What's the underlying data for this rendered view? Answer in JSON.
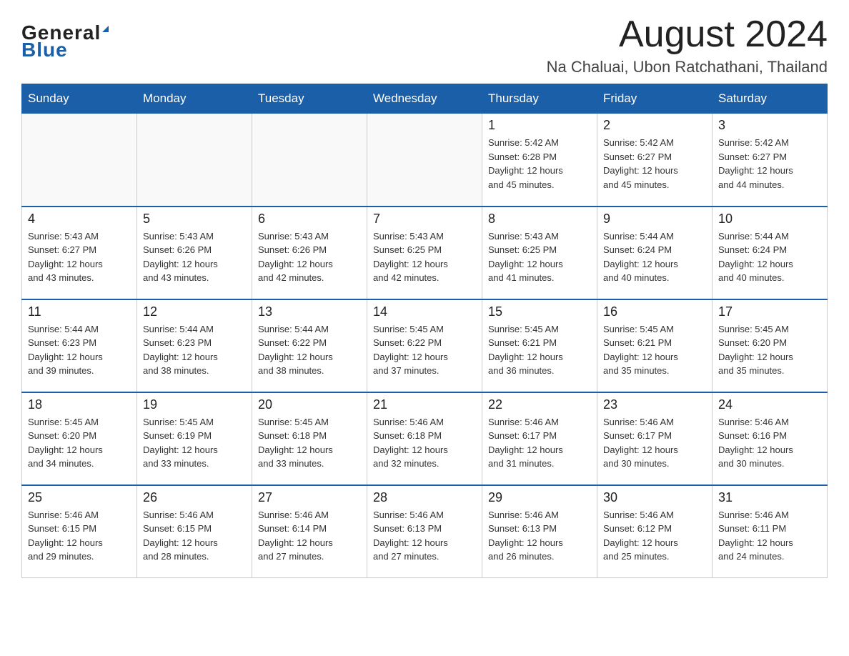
{
  "logo": {
    "general": "General",
    "blue": "Blue"
  },
  "title": "August 2024",
  "location": "Na Chaluai, Ubon Ratchathani, Thailand",
  "days_of_week": [
    "Sunday",
    "Monday",
    "Tuesday",
    "Wednesday",
    "Thursday",
    "Friday",
    "Saturday"
  ],
  "weeks": [
    [
      {
        "day": "",
        "info": ""
      },
      {
        "day": "",
        "info": ""
      },
      {
        "day": "",
        "info": ""
      },
      {
        "day": "",
        "info": ""
      },
      {
        "day": "1",
        "info": "Sunrise: 5:42 AM\nSunset: 6:28 PM\nDaylight: 12 hours\nand 45 minutes."
      },
      {
        "day": "2",
        "info": "Sunrise: 5:42 AM\nSunset: 6:27 PM\nDaylight: 12 hours\nand 45 minutes."
      },
      {
        "day": "3",
        "info": "Sunrise: 5:42 AM\nSunset: 6:27 PM\nDaylight: 12 hours\nand 44 minutes."
      }
    ],
    [
      {
        "day": "4",
        "info": "Sunrise: 5:43 AM\nSunset: 6:27 PM\nDaylight: 12 hours\nand 43 minutes."
      },
      {
        "day": "5",
        "info": "Sunrise: 5:43 AM\nSunset: 6:26 PM\nDaylight: 12 hours\nand 43 minutes."
      },
      {
        "day": "6",
        "info": "Sunrise: 5:43 AM\nSunset: 6:26 PM\nDaylight: 12 hours\nand 42 minutes."
      },
      {
        "day": "7",
        "info": "Sunrise: 5:43 AM\nSunset: 6:25 PM\nDaylight: 12 hours\nand 42 minutes."
      },
      {
        "day": "8",
        "info": "Sunrise: 5:43 AM\nSunset: 6:25 PM\nDaylight: 12 hours\nand 41 minutes."
      },
      {
        "day": "9",
        "info": "Sunrise: 5:44 AM\nSunset: 6:24 PM\nDaylight: 12 hours\nand 40 minutes."
      },
      {
        "day": "10",
        "info": "Sunrise: 5:44 AM\nSunset: 6:24 PM\nDaylight: 12 hours\nand 40 minutes."
      }
    ],
    [
      {
        "day": "11",
        "info": "Sunrise: 5:44 AM\nSunset: 6:23 PM\nDaylight: 12 hours\nand 39 minutes."
      },
      {
        "day": "12",
        "info": "Sunrise: 5:44 AM\nSunset: 6:23 PM\nDaylight: 12 hours\nand 38 minutes."
      },
      {
        "day": "13",
        "info": "Sunrise: 5:44 AM\nSunset: 6:22 PM\nDaylight: 12 hours\nand 38 minutes."
      },
      {
        "day": "14",
        "info": "Sunrise: 5:45 AM\nSunset: 6:22 PM\nDaylight: 12 hours\nand 37 minutes."
      },
      {
        "day": "15",
        "info": "Sunrise: 5:45 AM\nSunset: 6:21 PM\nDaylight: 12 hours\nand 36 minutes."
      },
      {
        "day": "16",
        "info": "Sunrise: 5:45 AM\nSunset: 6:21 PM\nDaylight: 12 hours\nand 35 minutes."
      },
      {
        "day": "17",
        "info": "Sunrise: 5:45 AM\nSunset: 6:20 PM\nDaylight: 12 hours\nand 35 minutes."
      }
    ],
    [
      {
        "day": "18",
        "info": "Sunrise: 5:45 AM\nSunset: 6:20 PM\nDaylight: 12 hours\nand 34 minutes."
      },
      {
        "day": "19",
        "info": "Sunrise: 5:45 AM\nSunset: 6:19 PM\nDaylight: 12 hours\nand 33 minutes."
      },
      {
        "day": "20",
        "info": "Sunrise: 5:45 AM\nSunset: 6:18 PM\nDaylight: 12 hours\nand 33 minutes."
      },
      {
        "day": "21",
        "info": "Sunrise: 5:46 AM\nSunset: 6:18 PM\nDaylight: 12 hours\nand 32 minutes."
      },
      {
        "day": "22",
        "info": "Sunrise: 5:46 AM\nSunset: 6:17 PM\nDaylight: 12 hours\nand 31 minutes."
      },
      {
        "day": "23",
        "info": "Sunrise: 5:46 AM\nSunset: 6:17 PM\nDaylight: 12 hours\nand 30 minutes."
      },
      {
        "day": "24",
        "info": "Sunrise: 5:46 AM\nSunset: 6:16 PM\nDaylight: 12 hours\nand 30 minutes."
      }
    ],
    [
      {
        "day": "25",
        "info": "Sunrise: 5:46 AM\nSunset: 6:15 PM\nDaylight: 12 hours\nand 29 minutes."
      },
      {
        "day": "26",
        "info": "Sunrise: 5:46 AM\nSunset: 6:15 PM\nDaylight: 12 hours\nand 28 minutes."
      },
      {
        "day": "27",
        "info": "Sunrise: 5:46 AM\nSunset: 6:14 PM\nDaylight: 12 hours\nand 27 minutes."
      },
      {
        "day": "28",
        "info": "Sunrise: 5:46 AM\nSunset: 6:13 PM\nDaylight: 12 hours\nand 27 minutes."
      },
      {
        "day": "29",
        "info": "Sunrise: 5:46 AM\nSunset: 6:13 PM\nDaylight: 12 hours\nand 26 minutes."
      },
      {
        "day": "30",
        "info": "Sunrise: 5:46 AM\nSunset: 6:12 PM\nDaylight: 12 hours\nand 25 minutes."
      },
      {
        "day": "31",
        "info": "Sunrise: 5:46 AM\nSunset: 6:11 PM\nDaylight: 12 hours\nand 24 minutes."
      }
    ]
  ]
}
